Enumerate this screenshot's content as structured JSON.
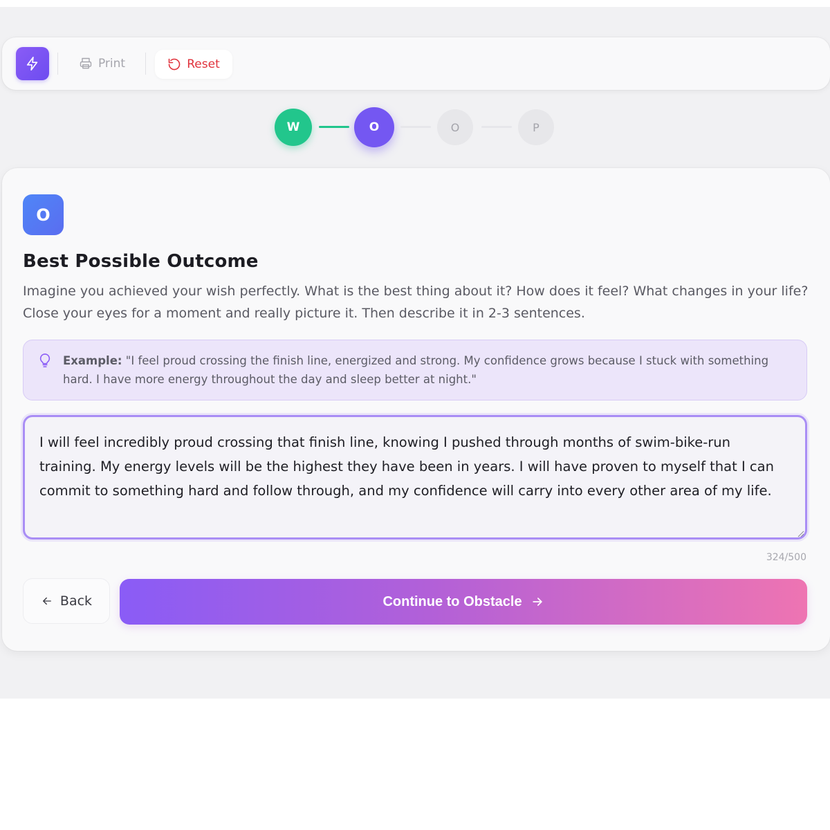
{
  "toolbar": {
    "logo_icon": "lightning-icon",
    "print_label": "Print",
    "reset_label": "Reset"
  },
  "stepper": {
    "steps": [
      {
        "letter": "W",
        "state": "done"
      },
      {
        "letter": "O",
        "state": "active"
      },
      {
        "letter": "O",
        "state": "pending"
      },
      {
        "letter": "P",
        "state": "pending"
      }
    ]
  },
  "card": {
    "badge": "O",
    "title": "Best Possible Outcome",
    "description": "Imagine you achieved your wish perfectly. What is the best thing about it? How does it feel? What changes in your life? Close your eyes for a moment and really picture it. Then describe it in 2-3 sentences.",
    "example_label": "Example:",
    "example_text": " \"I feel proud crossing the finish line, energized and strong. My confidence grows because I stuck with something hard. I have more energy throughout the day and sleep better at night.\"",
    "answer": "I will feel incredibly proud crossing that finish line, knowing I pushed through months of swim-bike-run training. My energy levels will be the highest they have been in years. I will have proven to myself that I can commit to something hard and follow through, and my confidence will carry into every other area of my life.",
    "counter": "324/500",
    "back_label": "Back",
    "continue_label": "Continue to Obstacle"
  },
  "colors": {
    "accent": "#7457f2",
    "done": "#22c68c",
    "reset": "#e0313b",
    "gradient_start": "#8a5cf6",
    "gradient_end": "#ee74b2"
  }
}
